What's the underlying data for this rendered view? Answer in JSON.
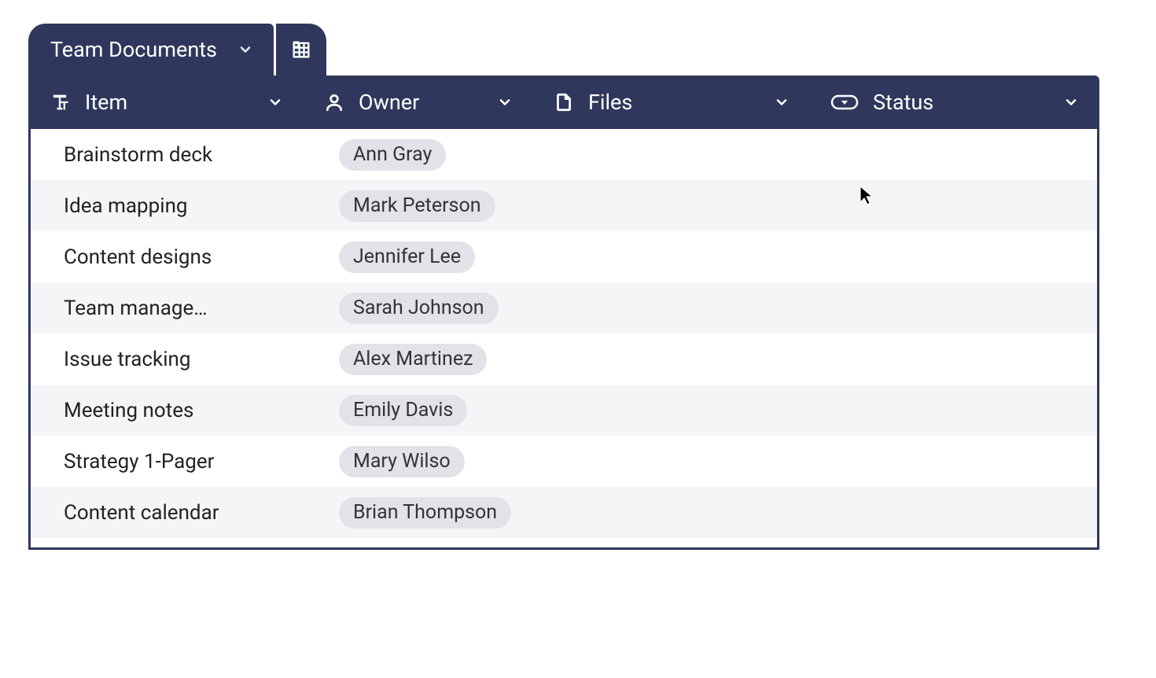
{
  "colors": {
    "primary": "#2f385c",
    "chip": "#e1e3e8",
    "rowAlt": "#f4f5f7"
  },
  "tab": {
    "label": "Team Documents"
  },
  "columns": [
    {
      "key": "item",
      "label": "Item",
      "icon": "text-icon"
    },
    {
      "key": "owner",
      "label": "Owner",
      "icon": "person-icon"
    },
    {
      "key": "files",
      "label": "Files",
      "icon": "file-icon"
    },
    {
      "key": "status",
      "label": "Status",
      "icon": "dropdown-pill-icon"
    }
  ],
  "rows": [
    {
      "item": "Brainstorm deck",
      "owner": "Ann Gray",
      "files": "",
      "status": ""
    },
    {
      "item": "Idea mapping",
      "owner": "Mark Peterson",
      "files": "",
      "status": ""
    },
    {
      "item": "Content designs",
      "owner": "Jennifer Lee",
      "files": "",
      "status": ""
    },
    {
      "item": "Team manage…",
      "owner": "Sarah Johnson",
      "files": "",
      "status": ""
    },
    {
      "item": "Issue tracking",
      "owner": "Alex Martinez",
      "files": "",
      "status": ""
    },
    {
      "item": "Meeting notes",
      "owner": "Emily Davis",
      "files": "",
      "status": ""
    },
    {
      "item": "Strategy 1-Pager",
      "owner": "Mary Wilso",
      "files": "",
      "status": ""
    },
    {
      "item": "Content calendar",
      "owner": "Brian Thompson",
      "files": "",
      "status": ""
    }
  ]
}
